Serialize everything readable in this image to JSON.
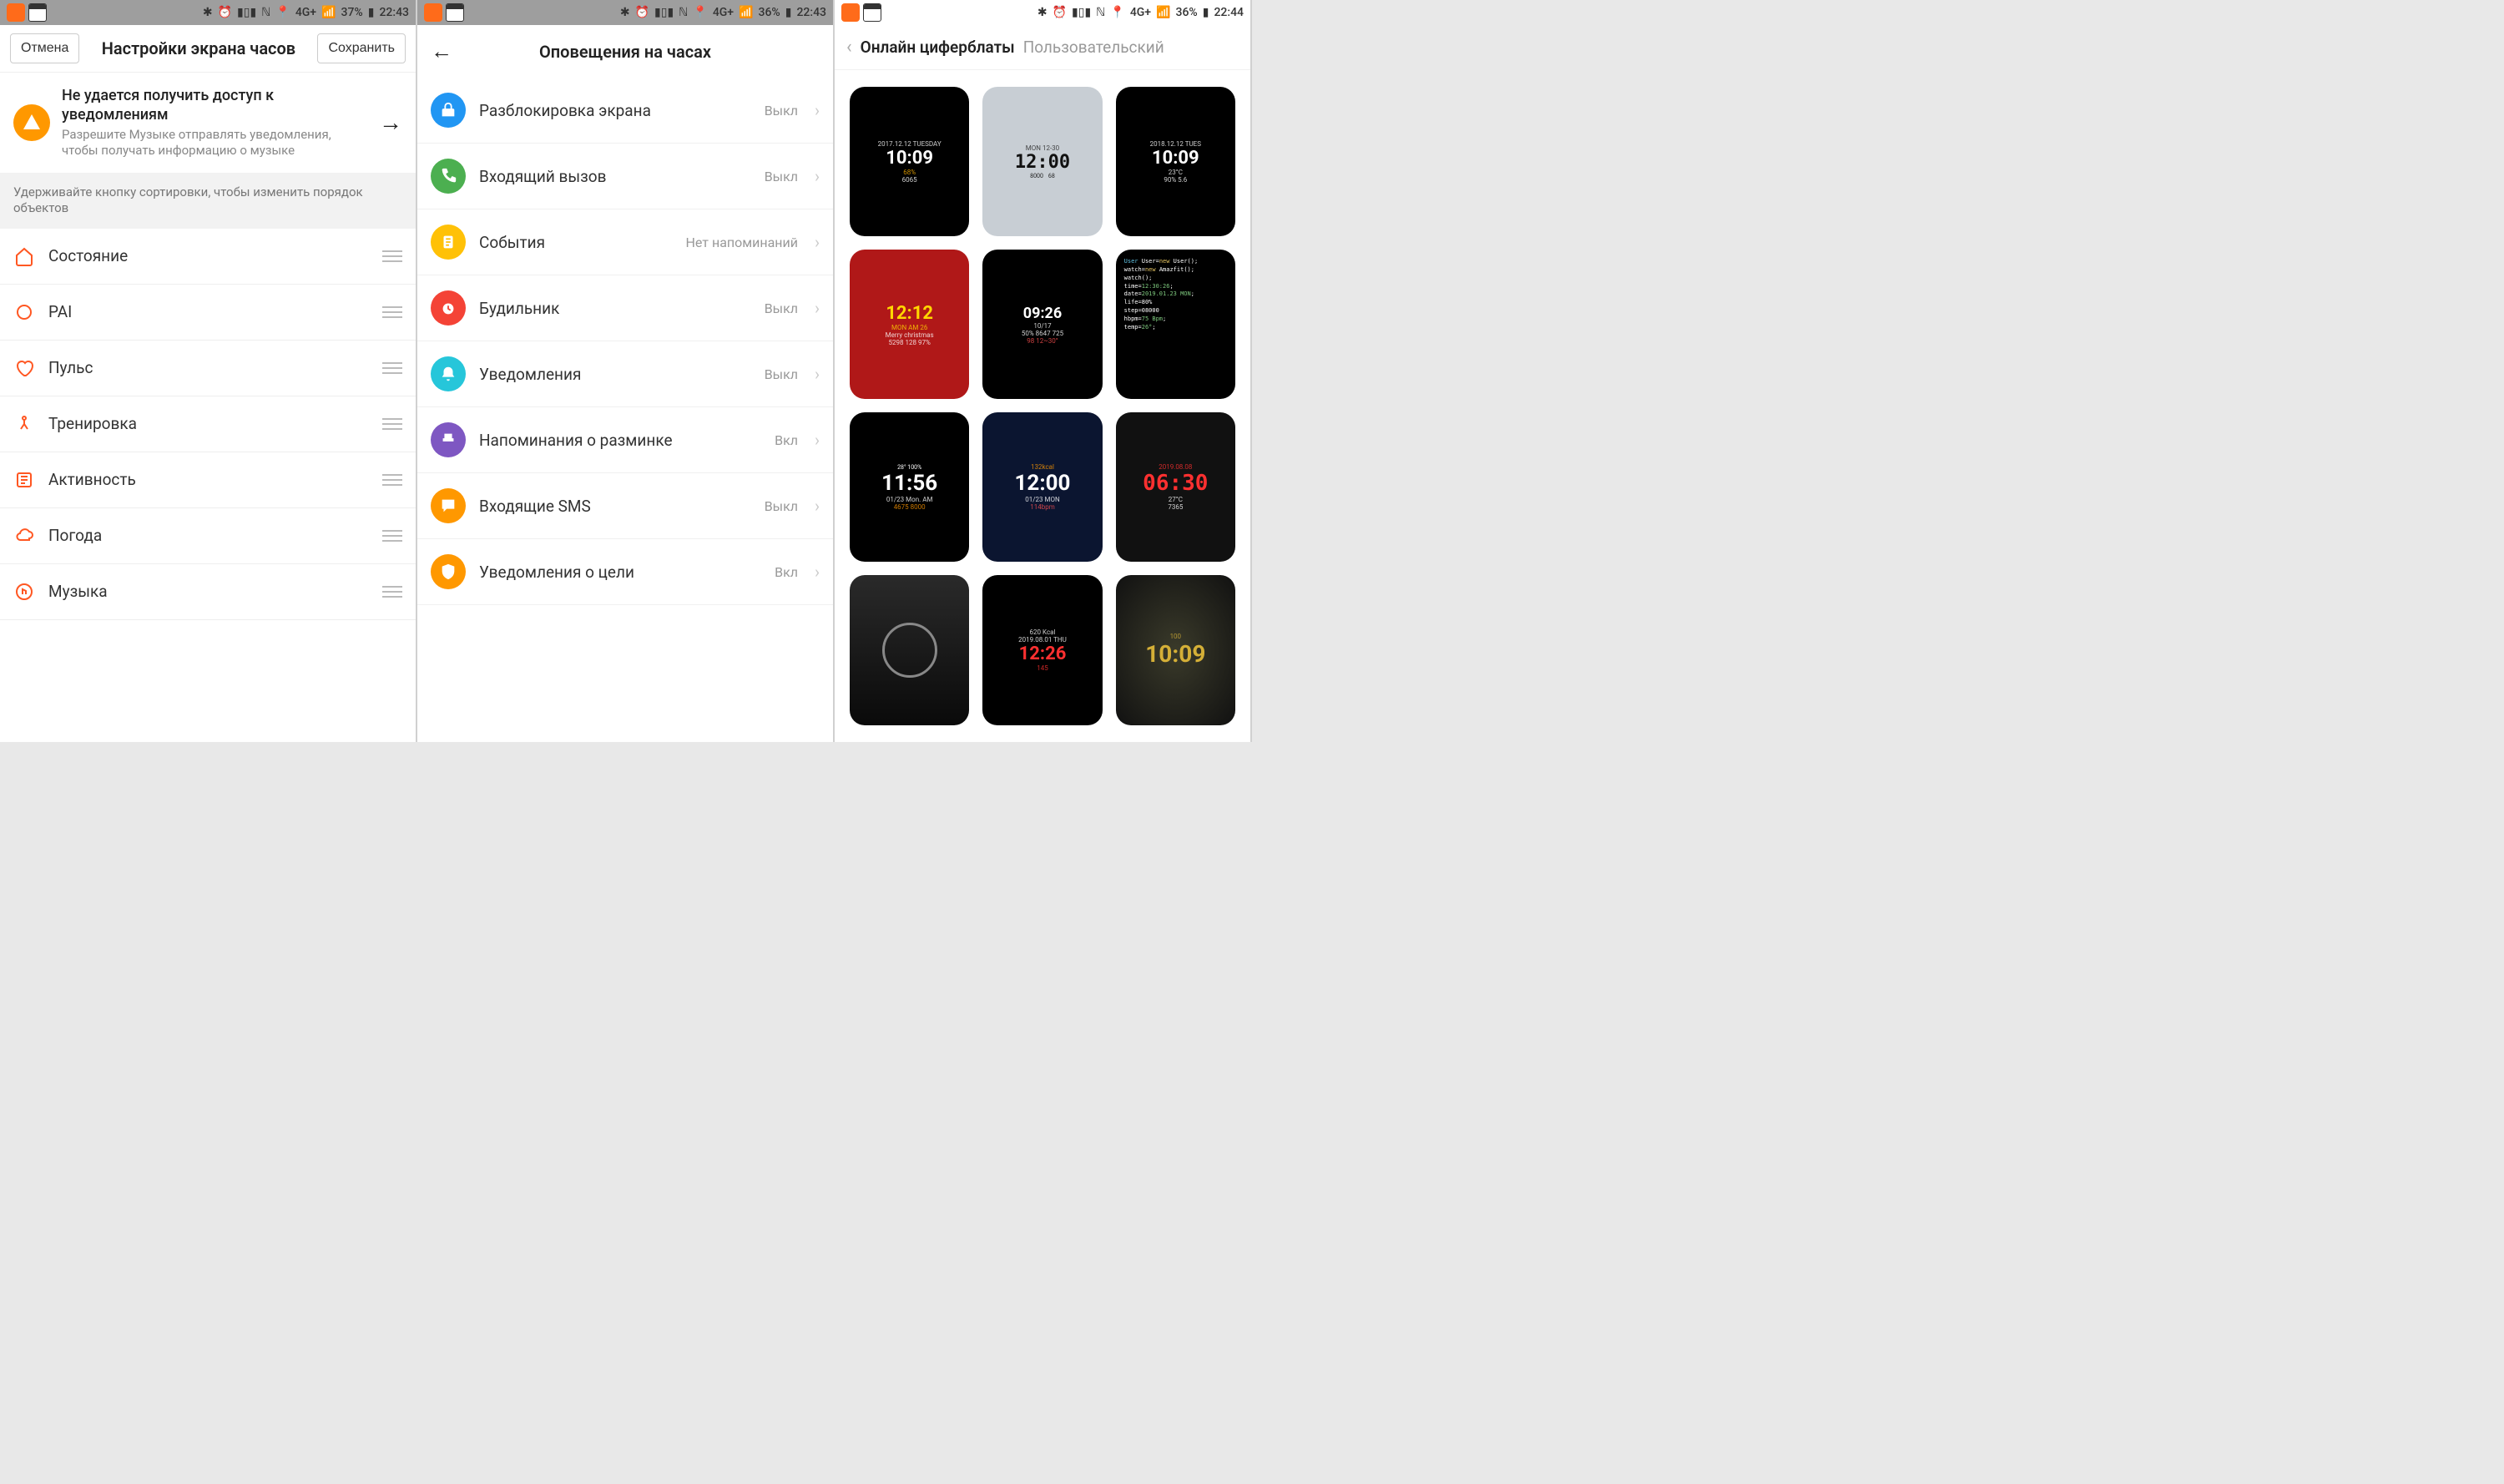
{
  "statusbar": {
    "battery1": "37%",
    "battery2": "36%",
    "battery3": "36%",
    "time1": "22:43",
    "time2": "22:43",
    "time3": "22:44",
    "net": "4G+"
  },
  "screen1": {
    "cancel": "Отмена",
    "save": "Сохранить",
    "title": "Настройки экрана часов",
    "warning_title": "Не удается получить доступ к уведомлениям",
    "warning_sub": "Разрешите Музыке отправлять уведомления, чтобы получать информацию о музыке",
    "hint": "Удерживайте кнопку сортировки, чтобы изменить порядок объектов",
    "items": [
      {
        "label": "Состояние"
      },
      {
        "label": "PAI"
      },
      {
        "label": "Пульс"
      },
      {
        "label": "Тренировка"
      },
      {
        "label": "Активность"
      },
      {
        "label": "Погода"
      },
      {
        "label": "Музыка"
      }
    ]
  },
  "screen2": {
    "title": "Оповещения на часах",
    "items": [
      {
        "label": "Разблокировка экрана",
        "status": "Выкл",
        "color": "#2196f3"
      },
      {
        "label": "Входящий вызов",
        "status": "Выкл",
        "color": "#4caf50"
      },
      {
        "label": "События",
        "status": "Нет напоминаний",
        "color": "#ffc107"
      },
      {
        "label": "Будильник",
        "status": "Выкл",
        "color": "#f44336"
      },
      {
        "label": "Уведомления",
        "status": "Выкл",
        "color": "#26c6da"
      },
      {
        "label": "Напоминания о разминке",
        "status": "Вкл",
        "color": "#7e57c2"
      },
      {
        "label": "Входящие SMS",
        "status": "Выкл",
        "color": "#ff9800"
      },
      {
        "label": "Уведомления о цели",
        "status": "Вкл",
        "color": "#ff9800"
      }
    ]
  },
  "screen3": {
    "tab_active": "Онлайн циферблаты",
    "tab_inactive": "Пользовательский",
    "faces": [
      {
        "time": "10:09",
        "date": "2017.12.12 TUESDAY",
        "extra": "68%",
        "sub": "6065"
      },
      {
        "time": "12:00",
        "date": "MON 12-30",
        "extra": "8000",
        "sub": "68"
      },
      {
        "time": "10:09",
        "date": "2018.12.12 TUES",
        "extra": "23°C",
        "sub": "90% 5.6"
      },
      {
        "time": "12:12",
        "date": "MON AM 26",
        "extra": "Merry christmas",
        "sub": "5298 128 97%"
      },
      {
        "time": "09:26",
        "date": "10/17",
        "extra": "98 12~30°",
        "sub": "50% 8647 725"
      },
      {
        "time": "12:30:26",
        "date": "2019.01.23 MON",
        "extra": "life=80%",
        "sub": "step=08000"
      },
      {
        "time": "11:56",
        "date": "01/23 Mon. AM",
        "extra": "28° 100%",
        "sub": "4675 8000"
      },
      {
        "time": "12:00",
        "date": "01/23 MON",
        "extra": "132kcal",
        "sub": "114bpm"
      },
      {
        "time": "06:30",
        "date": "2019.08.08",
        "extra": "27°C",
        "sub": "7365"
      },
      {
        "time": "",
        "date": "",
        "extra": "",
        "sub": ""
      },
      {
        "time": "12:26",
        "date": "2019.08.01 THU",
        "extra": "620 Kcal",
        "sub": "145"
      },
      {
        "time": "10:09",
        "date": "",
        "extra": "100",
        "sub": ""
      }
    ]
  }
}
